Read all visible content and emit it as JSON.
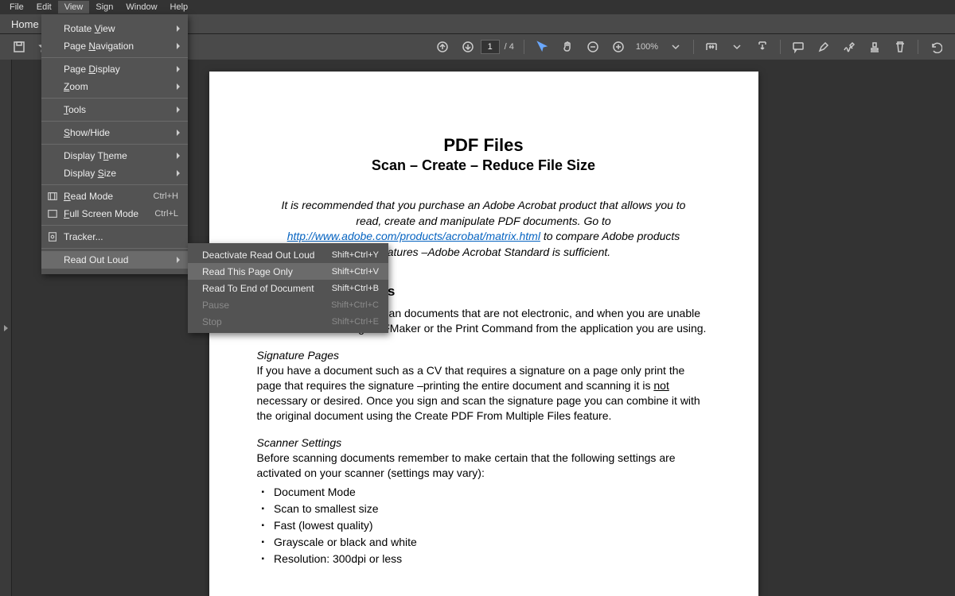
{
  "menubar": {
    "items": [
      "File",
      "Edit",
      "View",
      "Sign",
      "Window",
      "Help"
    ],
    "active_index": 2
  },
  "homerow": {
    "label": "Home"
  },
  "toolbar": {
    "page_current": "1",
    "page_total": "/ 4",
    "zoom": "100%"
  },
  "view_menu": {
    "groups": [
      [
        {
          "label": "Rotate View",
          "u": 7,
          "arrow": true
        },
        {
          "label": "Page Navigation",
          "u": 5,
          "arrow": true
        }
      ],
      [
        {
          "label": "Page Display",
          "u": 5,
          "arrow": true
        },
        {
          "label": "Zoom",
          "u": 0,
          "arrow": true
        }
      ],
      [
        {
          "label": "Tools",
          "u": 0,
          "arrow": true
        }
      ],
      [
        {
          "label": "Show/Hide",
          "u": 0,
          "arrow": true
        }
      ],
      [
        {
          "label": "Display Theme",
          "u": 9,
          "arrow": true
        },
        {
          "label": "Display Size",
          "u": 8,
          "arrow": true
        }
      ],
      [
        {
          "label": "Read Mode",
          "u": 0,
          "shortcut": "Ctrl+H",
          "icon": "read"
        },
        {
          "label": "Full Screen Mode",
          "u": 0,
          "shortcut": "Ctrl+L",
          "icon": "fullscreen"
        }
      ],
      [
        {
          "label": "Tracker...",
          "u": null,
          "icon": "tracker"
        }
      ],
      [
        {
          "label": "Read Out Loud",
          "u": null,
          "arrow": true,
          "active": true
        }
      ]
    ]
  },
  "submenu": {
    "items": [
      {
        "label": "Deactivate Read Out Loud",
        "shortcut": "Shift+Ctrl+Y"
      },
      {
        "label": "Read This Page Only",
        "shortcut": "Shift+Ctrl+V",
        "hl": true
      },
      {
        "label": "Read To End of Document",
        "shortcut": "Shift+Ctrl+B"
      },
      {
        "label": "Pause",
        "shortcut": "Shift+Ctrl+C",
        "dis": true
      },
      {
        "label": "Stop",
        "shortcut": "Shift+Ctrl+E",
        "dis": true
      }
    ]
  },
  "document": {
    "title1": "PDF Files",
    "title2": "Scan – Create – Reduce File Size",
    "intro_pre": "It is recommended that you purchase an Adobe Acrobat product that allows you to read, create and manipulate PDF documents.  Go to ",
    "intro_link": "http://www.adobe.com/products/acrobat/matrix.html",
    "intro_post": " to compare Adobe products and features –Adobe Acrobat Standard is sufficient.",
    "h_scan": "Scanning Documents",
    "p_scan": "You should only have to scan documents that are not electronic, and when you are unable to create a PDF using PDFMaker or the Print Command from the application you are using.",
    "sh_sig": "Signature Pages",
    "p_sig_a": "If you have a document such as a CV that requires a signature on a page only print the page that requires the signature –printing the entire document and scanning it is ",
    "p_sig_not": "not",
    "p_sig_b": " necessary or desired.  Once you sign and scan the signature page you can combine it with the original document using the Create PDF From Multiple Files feature.",
    "sh_set": "Scanner Settings",
    "p_set": "Before scanning documents remember to make certain that the following settings are activated on your scanner (settings may vary):",
    "bullets": [
      "Document Mode",
      "Scan to smallest size",
      "Fast (lowest quality)",
      "Grayscale or black and white",
      "Resolution: 300dpi or less"
    ]
  }
}
